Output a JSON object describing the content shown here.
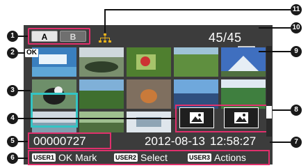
{
  "slots": {
    "a": "A",
    "b": "B"
  },
  "topbar": {
    "counter": "45/45"
  },
  "ok_badge": "OK",
  "status": {
    "clip_number": "00000727",
    "date": "2012-08-13",
    "time": "12:58:27"
  },
  "buttons": [
    {
      "key": "USER1",
      "action": "OK Mark"
    },
    {
      "key": "USER2",
      "action": "Select"
    },
    {
      "key": "USER3",
      "action": "Actions"
    }
  ],
  "callouts": [
    "1",
    "2",
    "3",
    "4",
    "5",
    "6",
    "7",
    "8",
    "9",
    "10",
    "11"
  ],
  "colors": {
    "highlight": "#e0306c",
    "cursor": "#33c4c4",
    "screen": "#3c3c3c"
  }
}
